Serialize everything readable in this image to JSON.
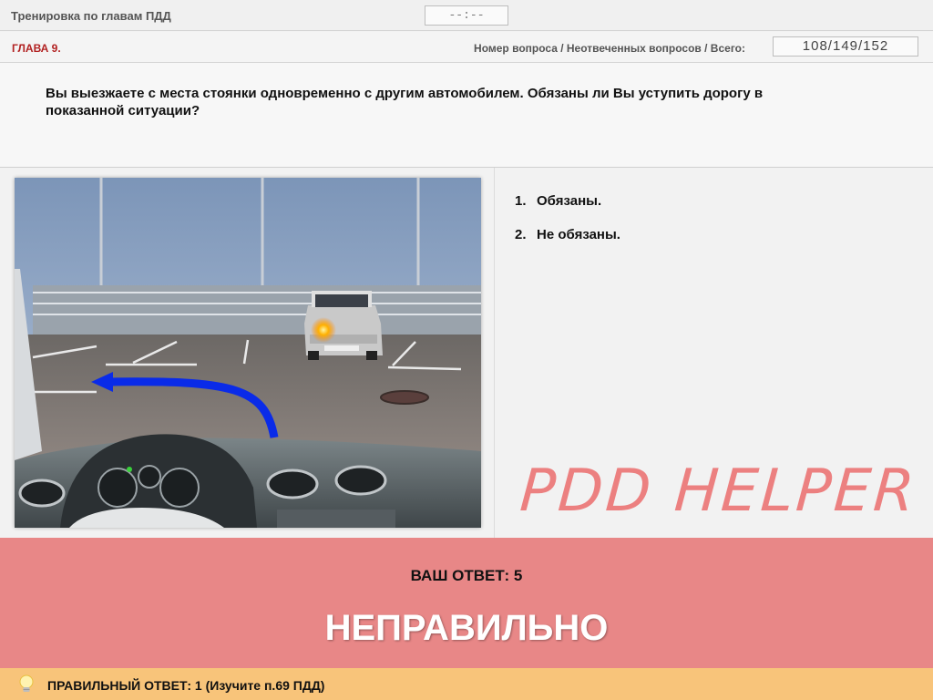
{
  "header": {
    "title": "Тренировка по главам ПДД",
    "timer": "--:--"
  },
  "info": {
    "chapter": "ГЛАВА 9.",
    "counter_label": "Номер вопроса / Неотвеченных вопросов / Всего:",
    "counter_value": "108/149/152"
  },
  "question": {
    "text": "Вы выезжаете с места стоянки одновременно с другим автомобилем. Обязаны ли Вы уступить дорогу в показанной ситуации?"
  },
  "answers": [
    {
      "num": "1.",
      "label": "Обязаны."
    },
    {
      "num": "2.",
      "label": "Не обязаны."
    }
  ],
  "watermark": "PDD HELPER",
  "result": {
    "your_answer": "ВАШ  ОТВЕТ:   5",
    "verdict": "НЕПРАВИЛЬНО"
  },
  "footer": {
    "correct_answer": "ПРАВИЛЬНЫЙ  ОТВЕТ:   1   (Изучите п.69 ПДД)"
  },
  "colors": {
    "chapter": "#b22222",
    "result_bg": "#e88787",
    "footer_bg": "#f8c47a",
    "watermark": "#ec8080",
    "arrow": "#0a2be8"
  }
}
